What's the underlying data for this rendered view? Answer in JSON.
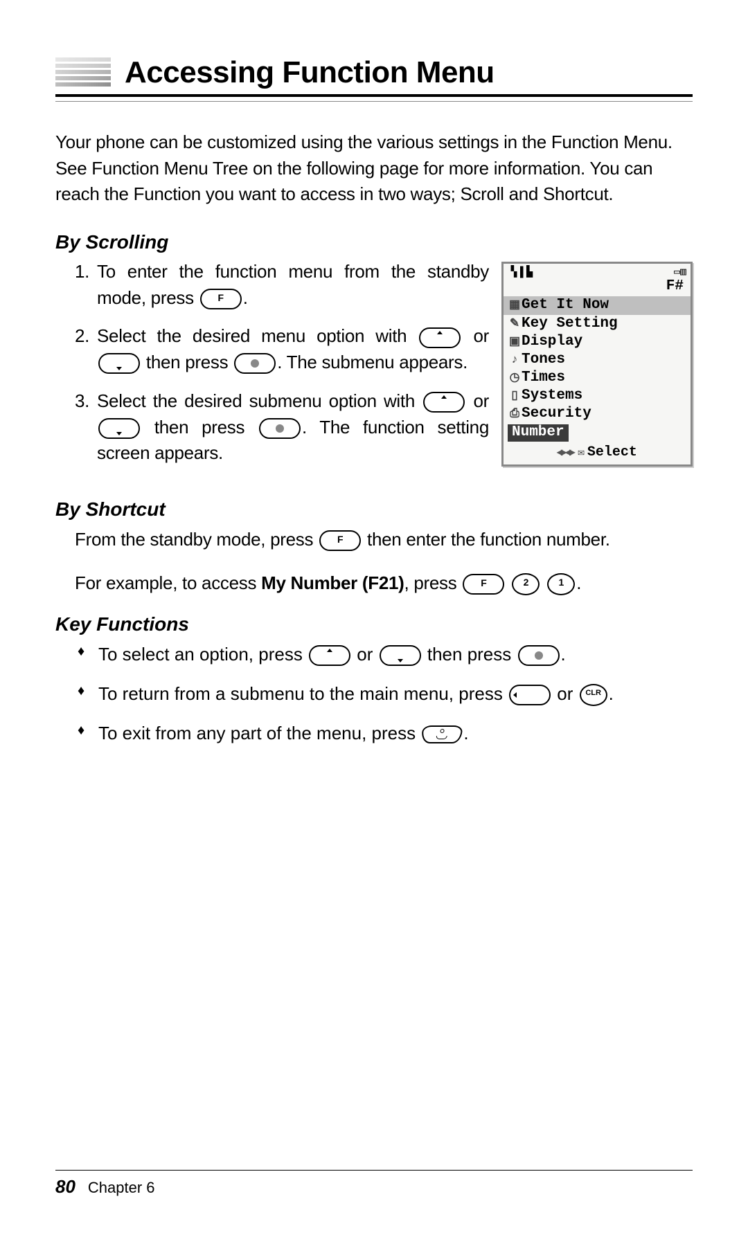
{
  "title": "Accessing Function Menu",
  "intro": "Your phone can be customized using the various settings in the Function Menu. See Function Menu Tree on the following page for more information. You can reach the Function you want to access in two ways; Scroll and Shortcut.",
  "scrolling": {
    "heading": "By Scrolling",
    "step1_a": "To enter the function menu from the standby mode, press ",
    "step1_b": ".",
    "step2_a": "Select the desired menu option with ",
    "step2_b": " or ",
    "step2_c": " then press ",
    "step2_d": ".  The submenu appears.",
    "step3_a": "Select the desired submenu option with ",
    "step3_b": " or ",
    "step3_c": " then press ",
    "step3_d": ".  The function setting screen appears."
  },
  "shortcut": {
    "heading": "By Shortcut",
    "p1_a": "From the standby mode, press ",
    "p1_b": " then enter the function number.",
    "p2_a": "For example, to access ",
    "p2_bold": "My Number (F21)",
    "p2_b": ", press ",
    "p2_c": "."
  },
  "keyfunc": {
    "heading": "Key Functions",
    "i1_a": "To select an option, press ",
    "i1_b": " or ",
    "i1_c": " then press ",
    "i1_d": ".",
    "i2_a": "To return from a submenu to the main menu, press ",
    "i2_b": " or ",
    "i2_c": ".",
    "i3_a": "To exit from any part of the menu, press ",
    "i3_b": "."
  },
  "keys": {
    "f": "F",
    "two": "2",
    "one": "1",
    "clr": "CLR"
  },
  "phone": {
    "fhash": "F#",
    "items": [
      {
        "icon": "▦",
        "label": "Get It Now",
        "selected": true
      },
      {
        "icon": "✎",
        "label": "Key Setting",
        "selected": false
      },
      {
        "icon": "▣",
        "label": "Display",
        "selected": false
      },
      {
        "icon": "♪",
        "label": "Tones",
        "selected": false
      },
      {
        "icon": "◷",
        "label": "Times",
        "selected": false
      },
      {
        "icon": "▯",
        "label": "Systems",
        "selected": false
      },
      {
        "icon": "⎙",
        "label": "Security",
        "selected": false
      }
    ],
    "number_label": "Number",
    "softkey": "Select"
  },
  "footer": {
    "page": "80",
    "chapter": "Chapter 6"
  }
}
